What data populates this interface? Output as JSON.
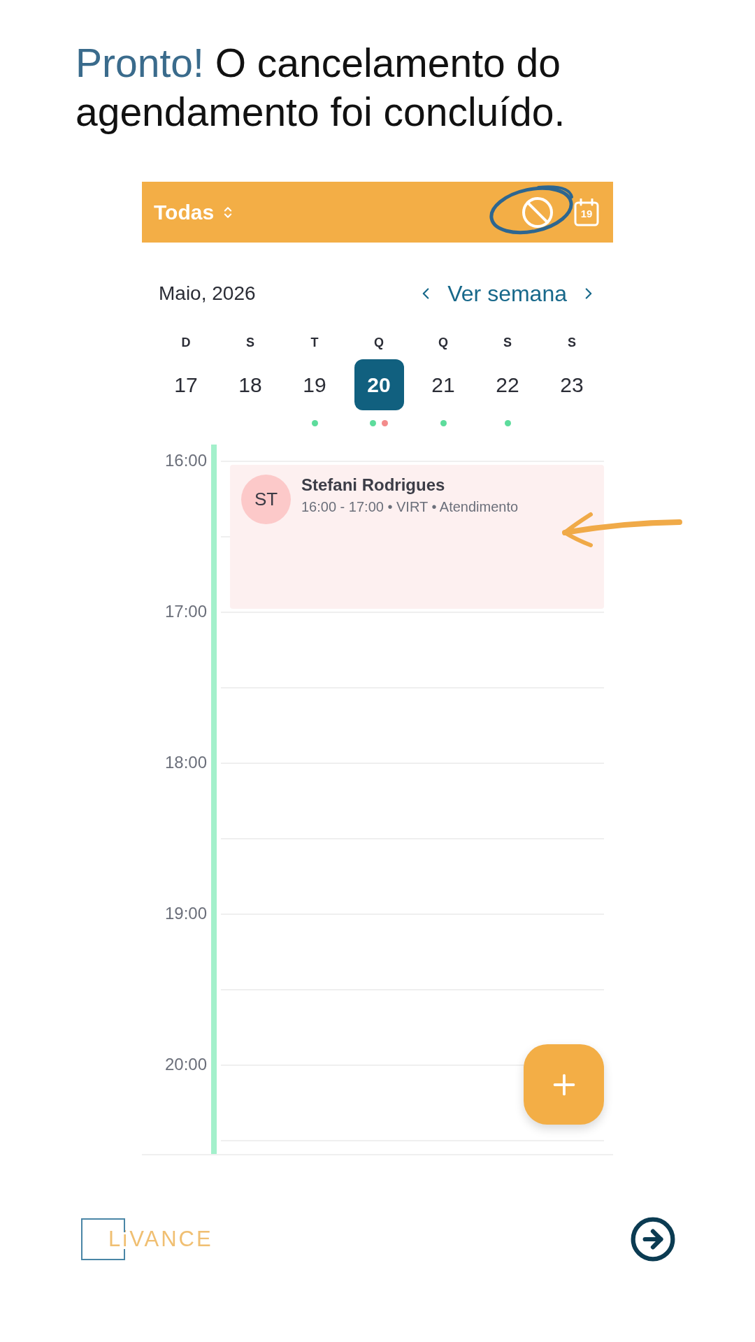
{
  "headline": {
    "accent": "Pronto!",
    "text": "O cancelamento do agendamento foi concluído."
  },
  "toolbar": {
    "filter": "Todas",
    "calendar_day": "19"
  },
  "calendar": {
    "month": "Maio, 2026",
    "view_link": "Ver semana",
    "days": [
      {
        "weekday": "D",
        "date": "17",
        "selected": false
      },
      {
        "weekday": "S",
        "date": "18",
        "selected": false
      },
      {
        "weekday": "T",
        "date": "19",
        "selected": false,
        "dots": [
          {
            "color": "#5ddc9c"
          }
        ]
      },
      {
        "weekday": "Q",
        "date": "20",
        "selected": true,
        "dots": [
          {
            "color": "#5ddc9c"
          },
          {
            "color": "#f38b8b"
          }
        ]
      },
      {
        "weekday": "Q",
        "date": "21",
        "selected": false,
        "dots": [
          {
            "color": "#5ddc9c"
          }
        ]
      },
      {
        "weekday": "S",
        "date": "22",
        "selected": false,
        "dots": [
          {
            "color": "#5ddc9c"
          }
        ]
      },
      {
        "weekday": "S",
        "date": "23",
        "selected": false
      }
    ]
  },
  "timeline": {
    "hours": [
      "16:00",
      "17:00",
      "18:00",
      "19:00",
      "20:00"
    ],
    "event": {
      "initials": "ST",
      "name": "Stefani Rodrigues",
      "details": "16:00 - 17:00 • VIRT • Atendimento"
    }
  },
  "footer": {
    "brand": "LiVANCE"
  }
}
